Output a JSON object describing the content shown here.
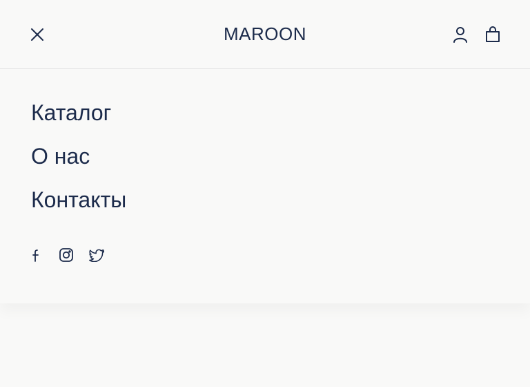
{
  "header": {
    "logo": "MAROON",
    "close_icon": "close-icon",
    "account_icon": "user-icon",
    "cart_icon": "shopping-bag-icon"
  },
  "menu": {
    "items": [
      {
        "label": "Каталог"
      },
      {
        "label": "О нас"
      },
      {
        "label": "Контакты"
      }
    ]
  },
  "social": {
    "icons": [
      "facebook-icon",
      "instagram-icon",
      "twitter-icon"
    ]
  },
  "colors": {
    "text": "#1c2b4b",
    "background": "#f9f9f8",
    "divider": "#e3e3e3"
  }
}
